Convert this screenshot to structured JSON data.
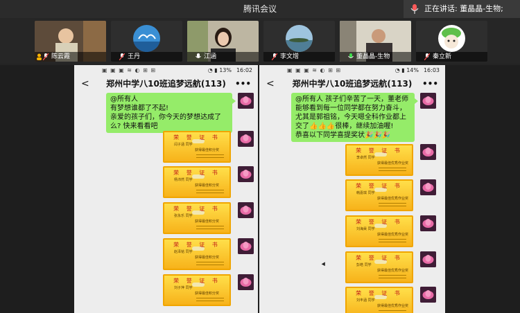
{
  "titlebar": {
    "title": "腾讯会议"
  },
  "speaking": {
    "label": "正在讲话: 董晶晶-生物;"
  },
  "participants": [
    {
      "name": "陈云霞"
    },
    {
      "name": "王丹"
    },
    {
      "name": "江涵"
    },
    {
      "name": "李文增"
    },
    {
      "name": "董晶晶-生物"
    },
    {
      "name": "秦立新"
    }
  ],
  "left_phone": {
    "status": {
      "icons": "▣ ▣ ▣ ≋ ◐ ⊞ ⊞",
      "battery": "◔ ▮ 13%",
      "time": "16:02"
    },
    "chat_title": "郑州中学八10班追梦远航(113)",
    "back": "<",
    "more": "•••",
    "message": "@所有人\n有梦想谁都了不起!\n亲爱的孩子们，你今天的梦想达成了么? 快来看看吧",
    "cert_title": "荣 誉 证 书",
    "certs": [
      {
        "name": "闫子涵 同学",
        "award": "获得最佳积分奖"
      },
      {
        "name": "杨沛然 同学",
        "award": "获得最佳积分奖"
      },
      {
        "name": "张永乐 同学",
        "award": "获得最佳积分奖"
      },
      {
        "name": "赵泽铭 同学",
        "award": "获得最佳积分奖"
      },
      {
        "name": "刘子萍 同学",
        "award": "获得最佳积分奖"
      }
    ]
  },
  "right_phone": {
    "status": {
      "icons": "▣ ▣ ▣ ≋ ◐ ⊞ ⊞",
      "battery": "◔ ▮ 14%",
      "time": "16:03"
    },
    "chat_title": "郑州中学八10班追梦远航(113)",
    "back": "<",
    "more": "•••",
    "message": "@所有人 孩子们辛苦了一天，董老师能够看到每一位同学都在努力奋斗，尤其是郭祖铭，今天嗯全科作业都上交了👍👍👍很棒，继续加油喔!\n恭喜以下同学喜提奖状🎉🎉🎉",
    "cert_title": "荣 誉 证 书",
    "certs": [
      {
        "name": "李卓然 同学",
        "award": "获得最佳优秀作业奖"
      },
      {
        "name": "韩嘉琪 同学",
        "award": "获得最佳优秀作业奖"
      },
      {
        "name": "刘海昊 同学",
        "award": "获得最佳优秀作业奖"
      },
      {
        "name": "彭皓 同学",
        "award": "获得最佳优秀作业奖"
      },
      {
        "name": "刘丰涵 同学",
        "award": "获得最佳优秀作业奖"
      }
    ]
  }
}
